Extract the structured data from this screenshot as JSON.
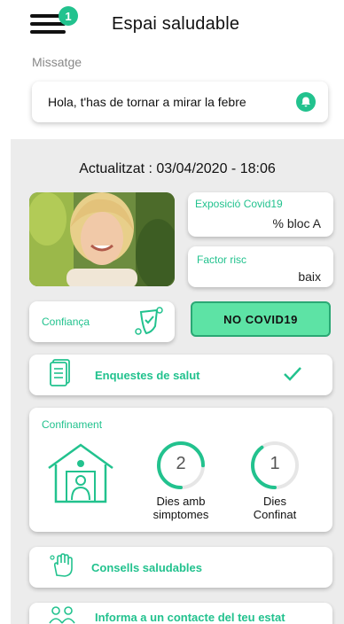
{
  "header": {
    "title": "Espai saludable",
    "notification_count": "1"
  },
  "message": {
    "label": "Missatge",
    "text": "Hola, t'has de tornar a mirar la febre"
  },
  "status": {
    "updated": "Actualitzat :  03/04/2020  - 18:06",
    "exposure": {
      "label": "Exposició Covid19",
      "value": "% bloc A"
    },
    "risk": {
      "label": "Factor risc",
      "value": "baix"
    },
    "trust": {
      "label": "Confiança"
    },
    "result": "NO COVID19"
  },
  "surveys": {
    "label": "Enquestes de salut"
  },
  "confinement": {
    "title": "Confinament",
    "symptom_days": {
      "value": "2",
      "label_line1": "Dies amb",
      "label_line2": "simptomes",
      "progress": 0.75
    },
    "confined_days": {
      "value": "1",
      "label_line1": "Dies",
      "label_line2": "Confinat",
      "progress": 0.4
    }
  },
  "advice": {
    "label": "Consells saludables"
  },
  "inform": {
    "label": "Informa a un contacte del teu estat"
  },
  "colors": {
    "accent": "#22c28e",
    "result_bg": "#5de3a5",
    "panel_bg": "#ececec"
  }
}
